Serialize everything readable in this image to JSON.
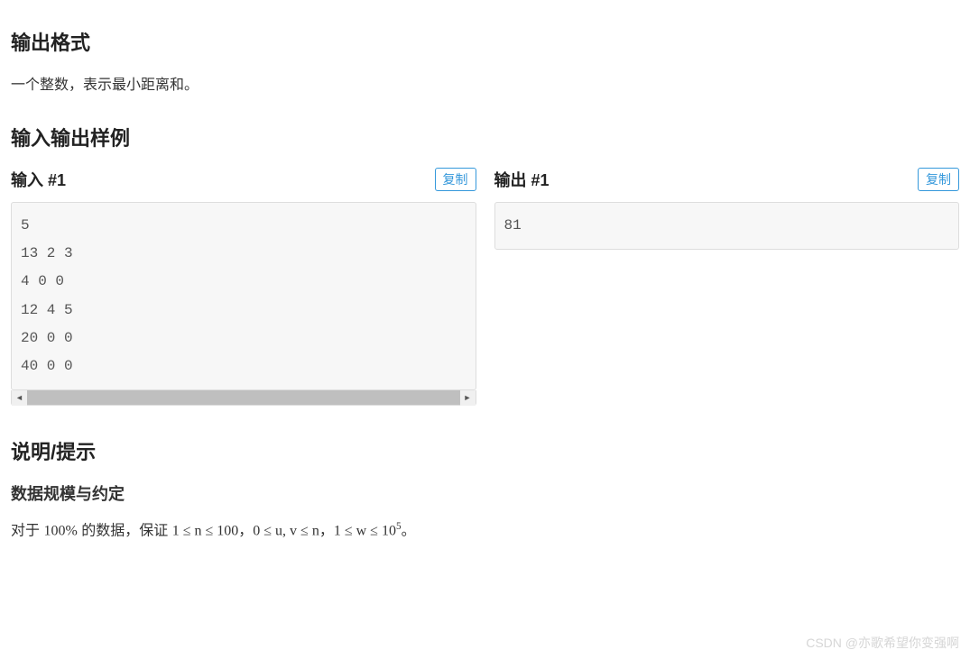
{
  "sections": {
    "outputFormat": {
      "heading": "输出格式",
      "body": "一个整数，表示最小距离和。"
    },
    "samples": {
      "heading": "输入输出样例",
      "inputLabel": "输入 #1",
      "outputLabel": "输出 #1",
      "copyLabel": "复制",
      "input": "5\n13 2 3\n4 0 0\n12 4 5\n20 0 0\n40 0 0",
      "output": "81"
    },
    "notes": {
      "heading": "说明/提示",
      "subheading": "数据规模与约定",
      "constraint_prefix": "对于 ",
      "constraint_pct": "100%",
      "constraint_mid1": " 的数据，保证 ",
      "c1": "1 ≤ n ≤ 100",
      "sep": "，",
      "c2": "0 ≤ u, v ≤ n",
      "c3_a": "1 ≤ w ≤ 10",
      "c3_exp": "5",
      "end": "。"
    }
  },
  "watermark": "CSDN @亦歌希望你变强啊"
}
